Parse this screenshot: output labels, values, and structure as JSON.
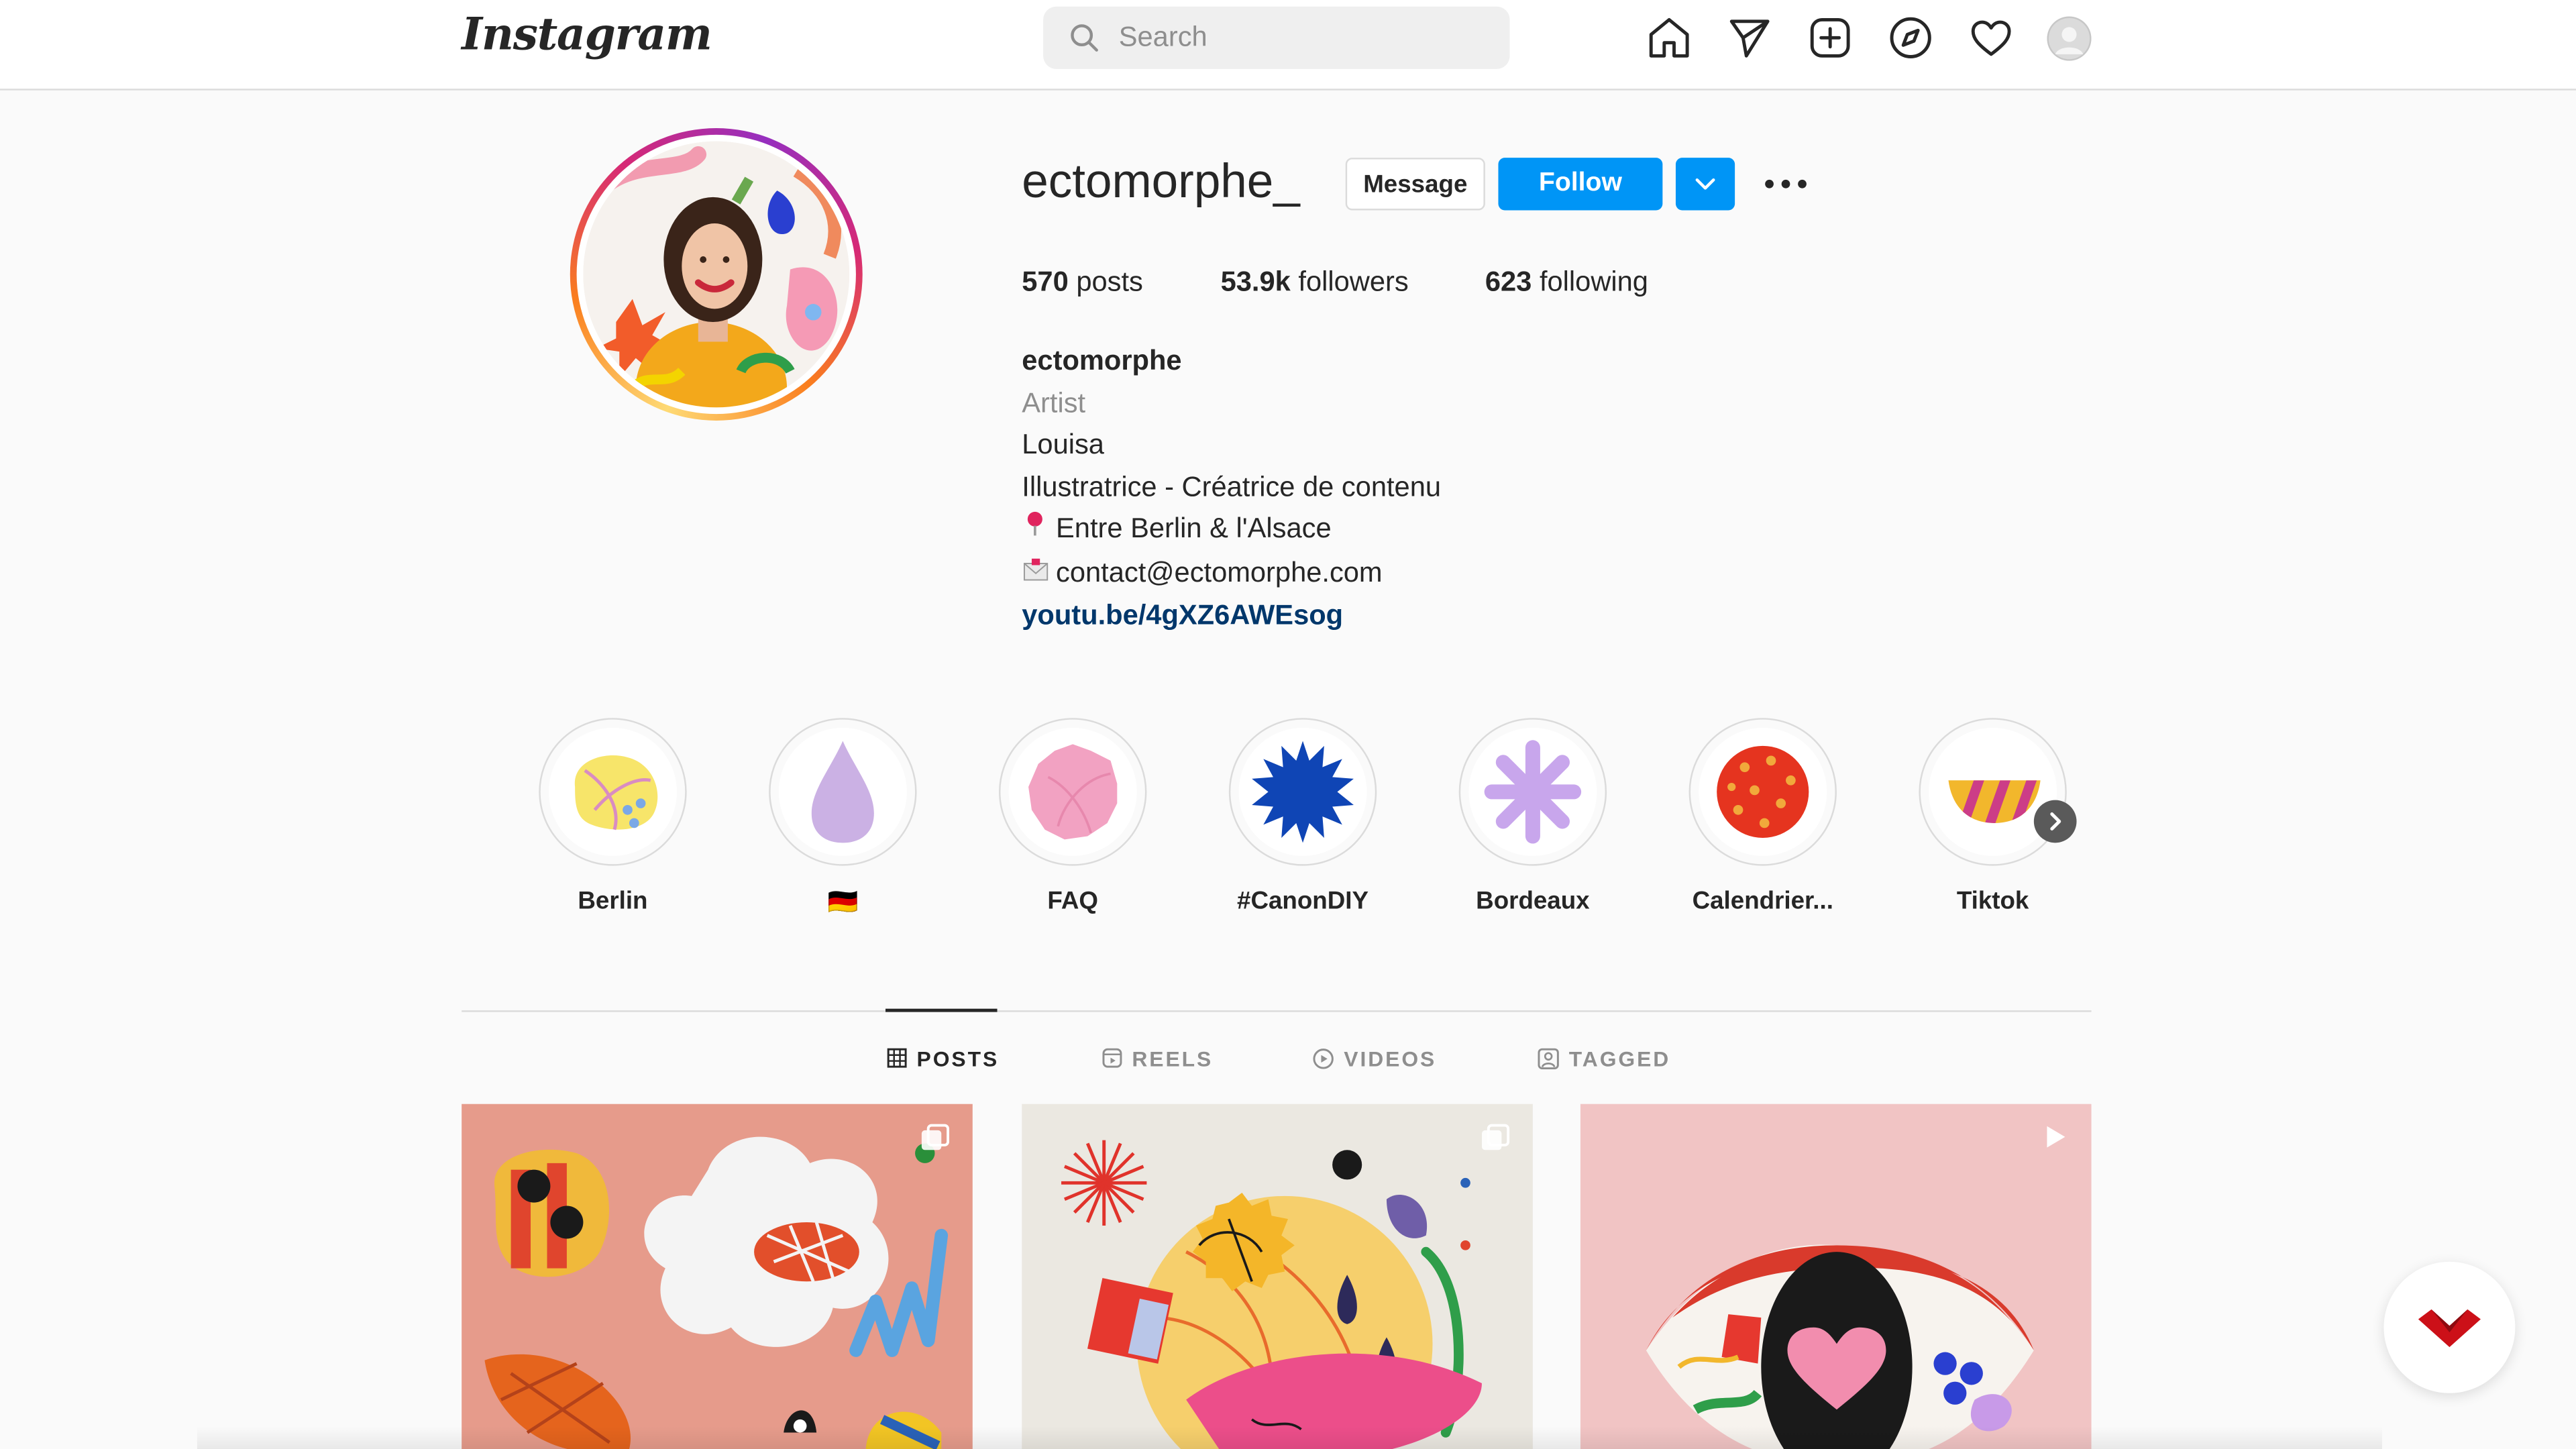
{
  "nav": {
    "logo": "Instagram",
    "search_placeholder": "Search",
    "icons": [
      "home-icon",
      "direct-icon",
      "new-post-icon",
      "explore-icon",
      "activity-icon",
      "profile-avatar"
    ]
  },
  "profile": {
    "username": "ectomorphe_",
    "message_label": "Message",
    "follow_label": "Follow",
    "stats": {
      "posts_count": "570",
      "posts_label": "posts",
      "followers_count": "53.9k",
      "followers_label": "followers",
      "following_count": "623",
      "following_label": "following"
    },
    "bio": {
      "full_name": "ectomorphe",
      "category": "Artist",
      "line1": "Louisa",
      "line2": "Illustratrice - Créatrice de contenu",
      "location": "Entre Berlin & l'Alsace",
      "email": "contact@ectomorphe.com",
      "link": "youtu.be/4gXZ6AWEsog"
    }
  },
  "highlights": [
    {
      "label": "Berlin"
    },
    {
      "label": "🇩🇪"
    },
    {
      "label": "FAQ"
    },
    {
      "label": "#CanonDIY"
    },
    {
      "label": "Bordeaux"
    },
    {
      "label": "Calendrier..."
    },
    {
      "label": "Tiktok"
    }
  ],
  "tabs": [
    {
      "label": "POSTS",
      "active": true
    },
    {
      "label": "REELS",
      "active": false
    },
    {
      "label": "VIDEOS",
      "active": false
    },
    {
      "label": "TAGGED",
      "active": false
    }
  ],
  "colors": {
    "accent": "#0095f6",
    "link": "#00376b",
    "border": "#dbdbdb",
    "muted": "#8e8e8e"
  }
}
